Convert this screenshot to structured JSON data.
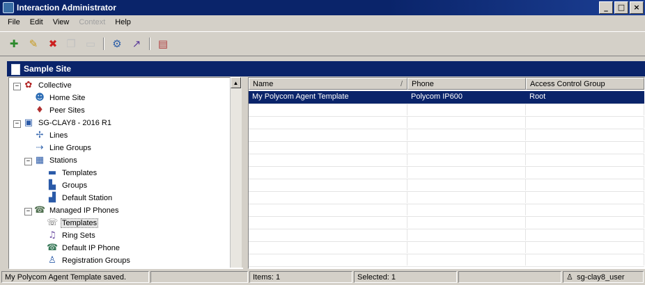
{
  "window": {
    "title": "Interaction Administrator",
    "btn_min": "_",
    "btn_max": "□",
    "btn_close": "×"
  },
  "menu": {
    "items": [
      {
        "label": "File",
        "disabled": false
      },
      {
        "label": "Edit",
        "disabled": false
      },
      {
        "label": "View",
        "disabled": false
      },
      {
        "label": "Context",
        "disabled": true
      },
      {
        "label": "Help",
        "disabled": false
      }
    ]
  },
  "toolbar": {
    "icons": [
      "new-icon",
      "edit-icon",
      "delete-icon",
      "copy-icon",
      "paste-icon",
      "connect-icon",
      "tools-icon",
      "properties-icon"
    ]
  },
  "site": {
    "title": "Sample Site"
  },
  "tree": {
    "items": [
      {
        "label": "Collective",
        "icon": "collective-icon"
      },
      {
        "label": "Home Site",
        "icon": "home-site-icon"
      },
      {
        "label": "Peer Sites",
        "icon": "peer-sites-icon"
      },
      {
        "label": "SG-CLAY8 - 2016 R1",
        "icon": "server-icon"
      },
      {
        "label": "Lines",
        "icon": "lines-icon"
      },
      {
        "label": "Line Groups",
        "icon": "line-groups-icon"
      },
      {
        "label": "Stations",
        "icon": "stations-icon"
      },
      {
        "label": "Templates",
        "icon": "templates-icon"
      },
      {
        "label": "Groups",
        "icon": "groups-icon"
      },
      {
        "label": "Default Station",
        "icon": "default-station-icon"
      },
      {
        "label": "Managed IP Phones",
        "icon": "managed-phones-icon"
      },
      {
        "label": "Templates",
        "icon": "phone-templates-icon",
        "selected": true
      },
      {
        "label": "Ring Sets",
        "icon": "ring-sets-icon"
      },
      {
        "label": "Default IP Phone",
        "icon": "default-phone-icon"
      },
      {
        "label": "Registration Groups",
        "icon": "registration-groups-icon"
      }
    ]
  },
  "list": {
    "columns": [
      "Name",
      "Phone",
      "Access Control Group"
    ],
    "rows": [
      {
        "name": "My Polycom Agent Template",
        "phone": "Polycom IP600",
        "acg": "Root"
      }
    ]
  },
  "status": {
    "message": "My Polycom Agent Template saved.",
    "items": "Items: 1",
    "selected": "Selected: 1",
    "user": "sg-clay8_user"
  },
  "colors": {
    "title_bar": "#0a246a",
    "selection": "#0a246a",
    "chrome": "#d4d0c8"
  }
}
